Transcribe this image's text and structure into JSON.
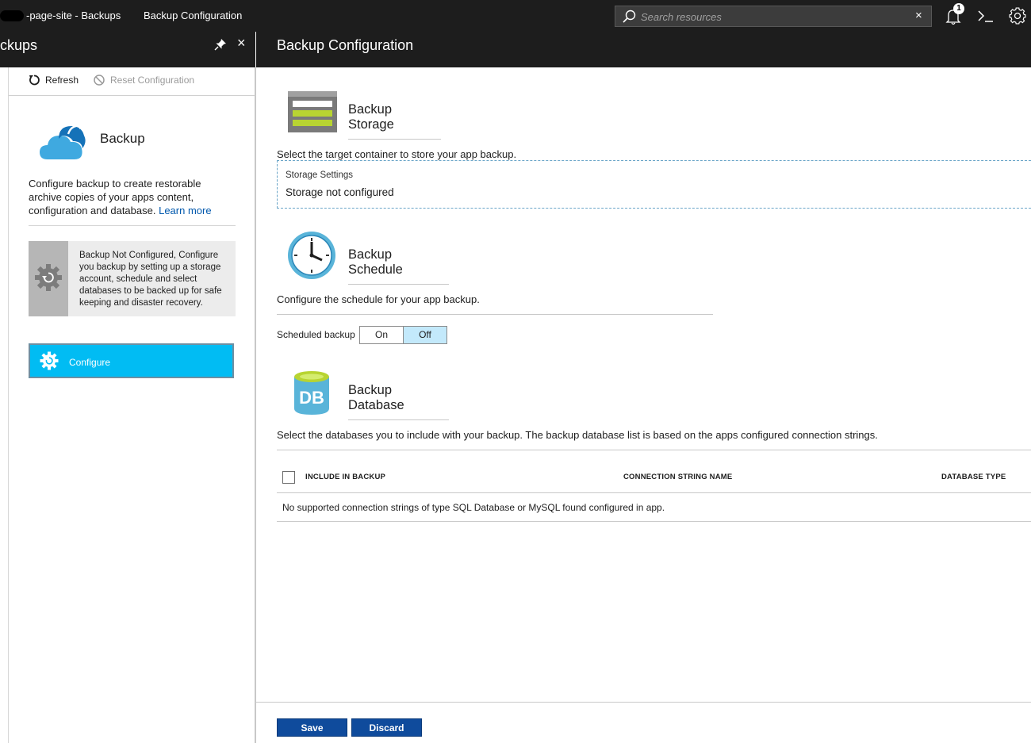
{
  "topbar": {
    "crumb_site": "-page-site - Backups",
    "crumb_config": "Backup Configuration",
    "search_placeholder": "Search resources",
    "search_clear": "×",
    "notification_count": "1"
  },
  "left_blade": {
    "title": "ckups",
    "close": "×",
    "commands": {
      "refresh": "Refresh",
      "reset": "Reset Configuration"
    },
    "backup_title": "Backup",
    "backup_desc": "Configure backup to create restorable archive copies of your apps content, configuration and database.",
    "learn_more": "Learn more",
    "notice": "Backup Not Configured, Configure you backup by setting up a storage account, schedule and select databases to be backed up for safe keeping and disaster recovery.",
    "configure_label": "Configure"
  },
  "right_blade": {
    "title": "Backup Configuration",
    "storage": {
      "title": "Backup Storage",
      "desc": "Select the target container to store your app backup.",
      "settings_label": "Storage Settings",
      "settings_value": "Storage not configured"
    },
    "schedule": {
      "title": "Backup Schedule",
      "desc": "Configure the schedule for your app backup.",
      "scheduled_label": "Scheduled backup",
      "on": "On",
      "off": "Off",
      "selected": "Off"
    },
    "database": {
      "title": "Backup Database",
      "desc": "Select the databases you to include with your backup. The backup database list is based on the apps configured connection strings.",
      "columns": [
        "INCLUDE IN BACKUP",
        "CONNECTION STRING NAME",
        "DATABASE TYPE"
      ],
      "empty": "No supported connection strings of type SQL Database or MySQL found configured in app."
    },
    "buttons": {
      "save": "Save",
      "discard": "Discard"
    }
  },
  "colors": {
    "chrome": "#1d1d1d",
    "configure_accent": "#01bcf3",
    "button_blue": "#0f4b9c",
    "toggle_selected": "#c3e9fb",
    "link": "#0058ad"
  }
}
